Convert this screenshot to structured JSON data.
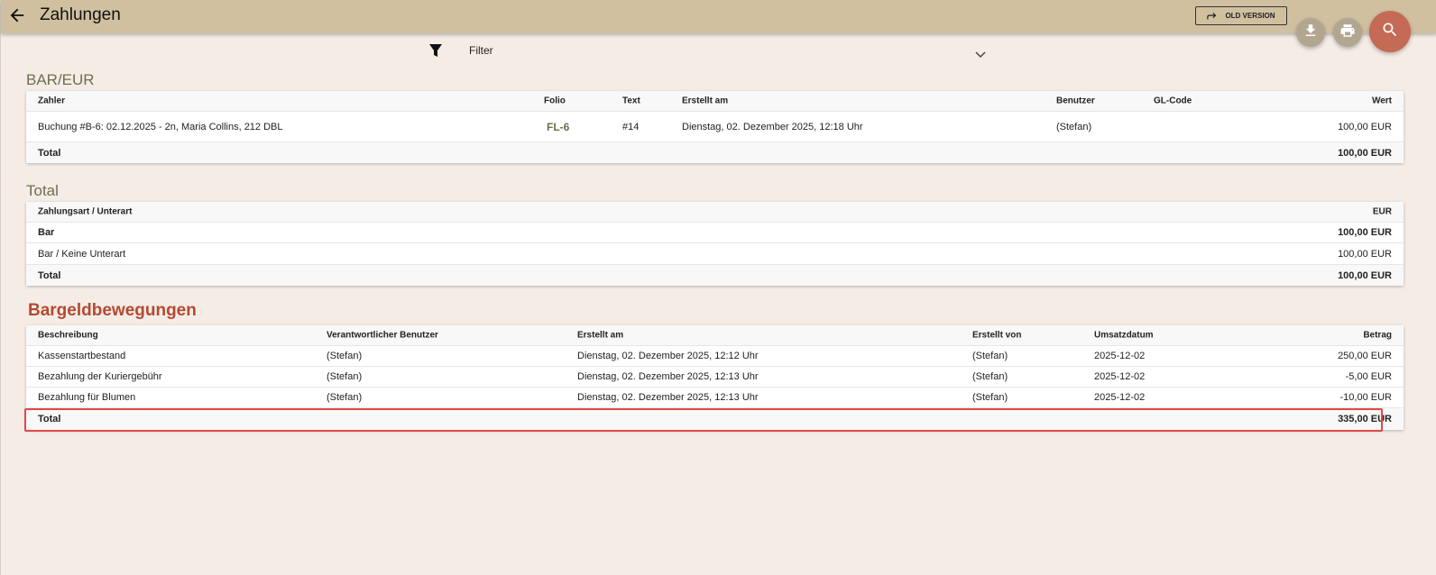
{
  "header": {
    "title": "Zahlungen",
    "old_version_label": "OLD VERSION",
    "back_icon": "arrow-left-icon",
    "download_icon": "download-icon",
    "print_icon": "print-icon",
    "search_icon": "search-icon"
  },
  "filter": {
    "label": "Filter",
    "icon": "funnel-icon"
  },
  "colors": {
    "topbar": "#d0c0a0",
    "background": "#f5ece6",
    "accent_red": "#b34a32",
    "accent_olive": "#6b7050",
    "fab_search": "#c46a55",
    "highlight": "#e04848"
  },
  "payments": {
    "title": "BAR/EUR",
    "columns": {
      "payer": "Zahler",
      "folio": "Folio",
      "text": "Text",
      "created": "Erstellt am",
      "user": "Benutzer",
      "gl_code": "GL-Code",
      "value": "Wert"
    },
    "rows": [
      {
        "payer": "Buchung #B-6: 02.12.2025 - 2n, Maria Collins, 212 DBL",
        "folio": "FL-6",
        "text": "#14",
        "created": "Dienstag, 02. Dezember 2025, 12:18 Uhr",
        "user": "(Stefan)",
        "gl_code": "",
        "value": "100,00 EUR"
      }
    ],
    "total_label": "Total",
    "total_value": "100,00 EUR"
  },
  "totals": {
    "title": "Total",
    "columns": {
      "type": "Zahlungsart / Unterart",
      "currency": "EUR"
    },
    "rows": [
      {
        "label": "Bar",
        "value": "100,00 EUR"
      },
      {
        "label": "Bar / Keine Unterart",
        "value": "100,00 EUR"
      }
    ],
    "total_label": "Total",
    "total_value": "100,00 EUR"
  },
  "cash": {
    "title": "Bargeldbewegungen",
    "columns": {
      "description": "Beschreibung",
      "responsible": "Verantwortlicher Benutzer",
      "created": "Erstellt am",
      "created_by": "Erstellt von",
      "date": "Umsatzdatum",
      "amount": "Betrag"
    },
    "rows": [
      {
        "description": "Kassenstartbestand",
        "responsible": "(Stefan)",
        "created": "Dienstag, 02. Dezember 2025, 12:12 Uhr",
        "created_by": "(Stefan)",
        "date": "2025-12-02",
        "amount": "250,00 EUR"
      },
      {
        "description": "Bezahlung der Kuriergebühr",
        "responsible": "(Stefan)",
        "created": "Dienstag, 02. Dezember 2025, 12:13 Uhr",
        "created_by": "(Stefan)",
        "date": "2025-12-02",
        "amount": "-5,00 EUR"
      },
      {
        "description": "Bezahlung für Blumen",
        "responsible": "(Stefan)",
        "created": "Dienstag, 02. Dezember 2025, 12:13 Uhr",
        "created_by": "(Stefan)",
        "date": "2025-12-02",
        "amount": "-10,00 EUR"
      }
    ],
    "total_label": "Total",
    "total_value": "335,00 EUR"
  }
}
